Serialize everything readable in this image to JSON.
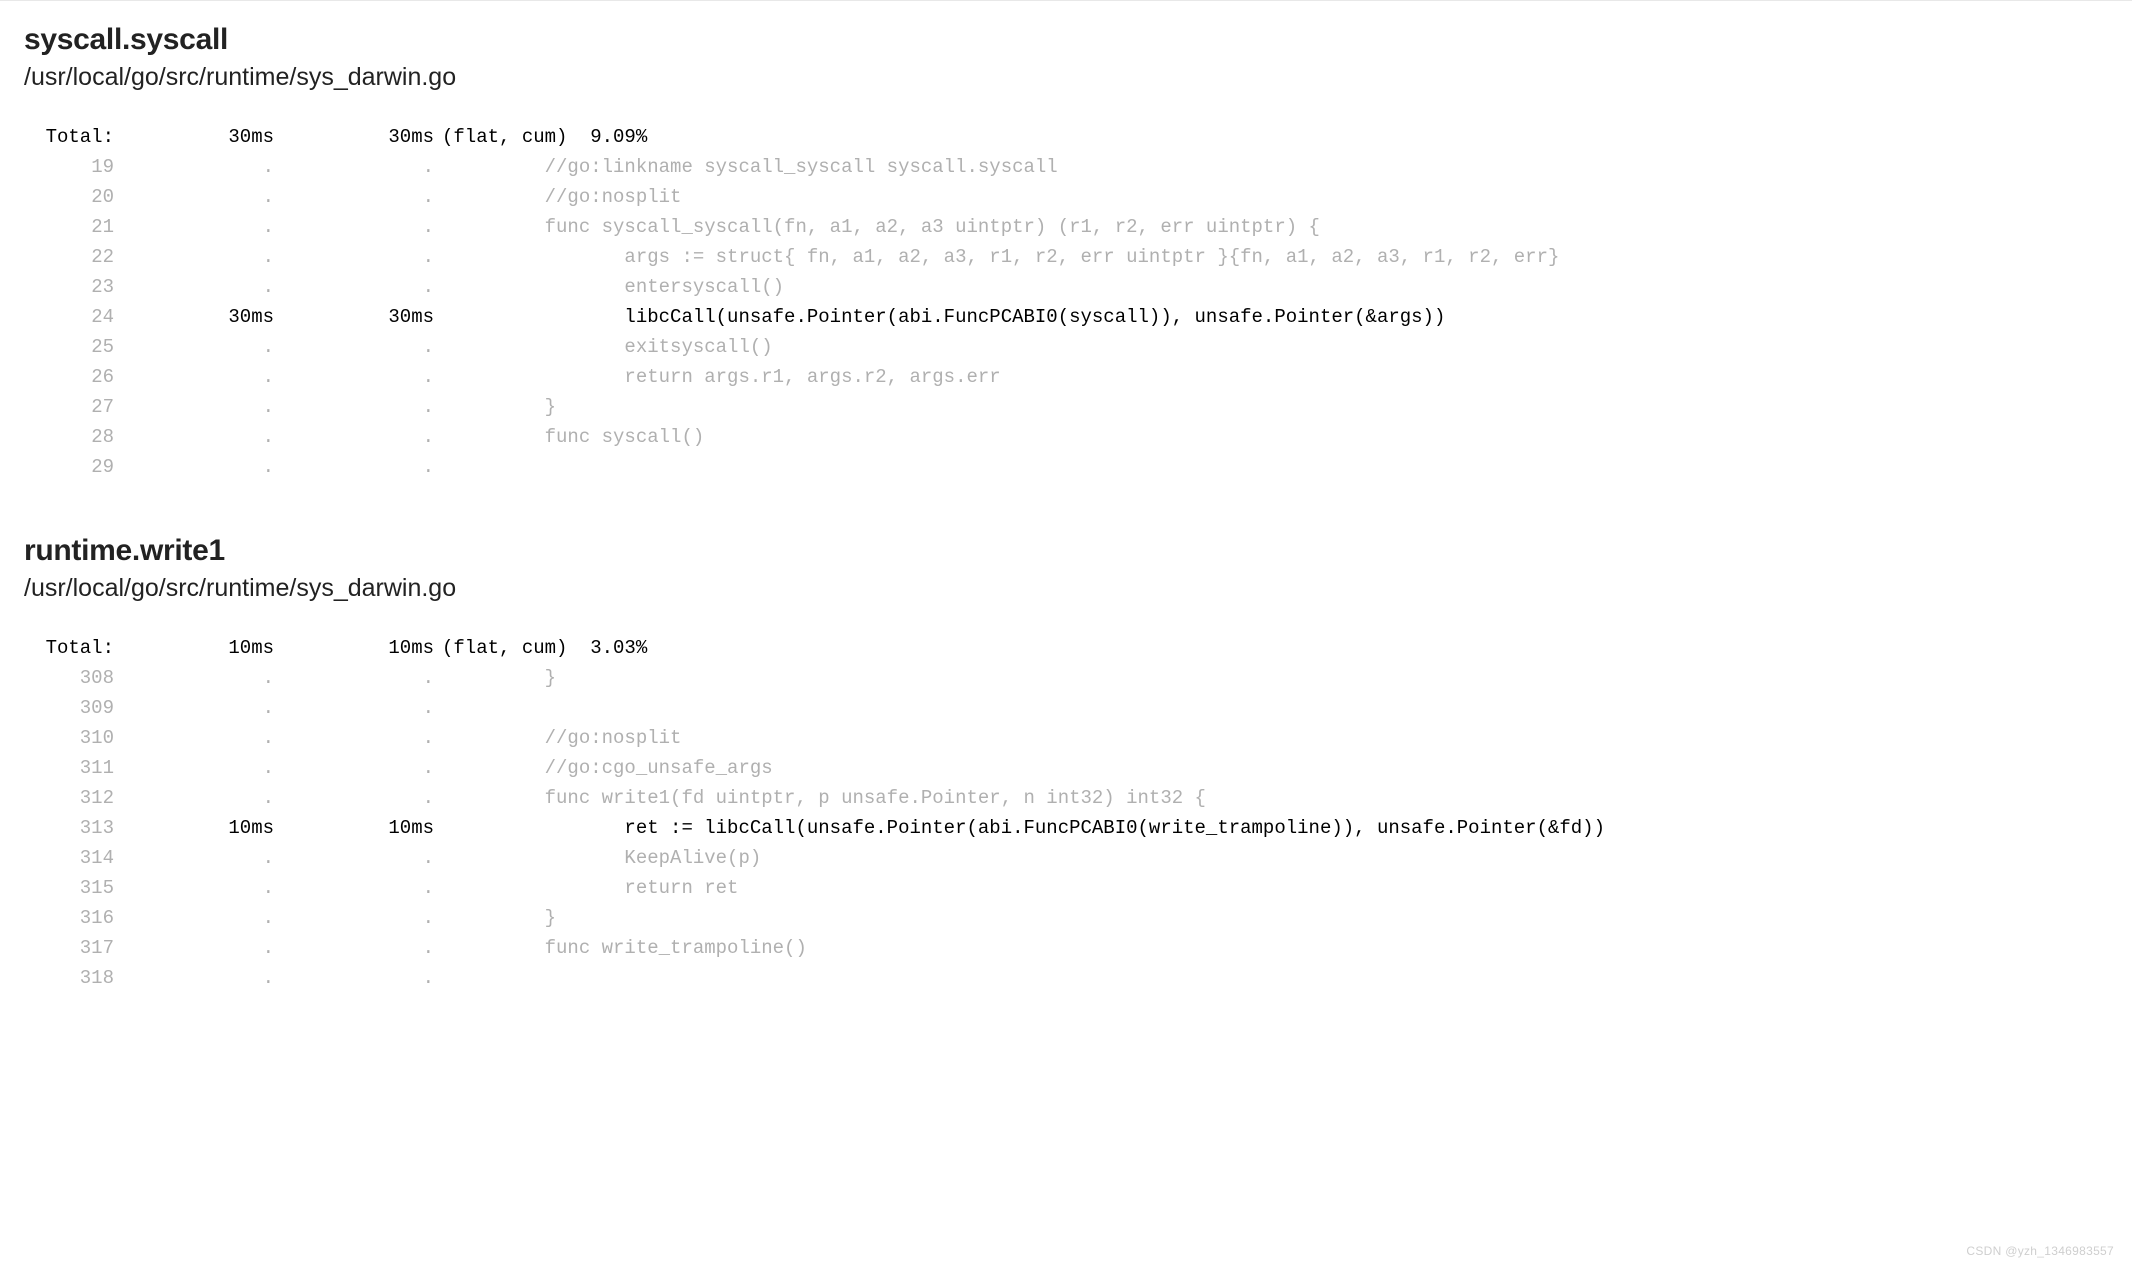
{
  "watermark": "CSDN @yzh_1346983557",
  "sections": [
    {
      "name": "syscall.syscall",
      "path": "/usr/local/go/src/runtime/sys_darwin.go",
      "total": {
        "label": "Total:",
        "flat": "30ms",
        "cum": "30ms",
        "meta": "(flat, cum)  9.09%"
      },
      "lines": [
        {
          "n": "19",
          "flat": ".",
          "cum": ".",
          "src": "         //go:linkname syscall_syscall syscall.syscall",
          "hl": false
        },
        {
          "n": "20",
          "flat": ".",
          "cum": ".",
          "src": "         //go:nosplit",
          "hl": false
        },
        {
          "n": "21",
          "flat": ".",
          "cum": ".",
          "src": "         func syscall_syscall(fn, a1, a2, a3 uintptr) (r1, r2, err uintptr) {",
          "hl": false
        },
        {
          "n": "22",
          "flat": ".",
          "cum": ".",
          "src": "                args := struct{ fn, a1, a2, a3, r1, r2, err uintptr }{fn, a1, a2, a3, r1, r2, err}",
          "hl": false
        },
        {
          "n": "23",
          "flat": ".",
          "cum": ".",
          "src": "                entersyscall()",
          "hl": false
        },
        {
          "n": "24",
          "flat": "30ms",
          "cum": "30ms",
          "src": "                libcCall(unsafe.Pointer(abi.FuncPCABI0(syscall)), unsafe.Pointer(&args))",
          "hl": true
        },
        {
          "n": "25",
          "flat": ".",
          "cum": ".",
          "src": "                exitsyscall()",
          "hl": false
        },
        {
          "n": "26",
          "flat": ".",
          "cum": ".",
          "src": "                return args.r1, args.r2, args.err",
          "hl": false
        },
        {
          "n": "27",
          "flat": ".",
          "cum": ".",
          "src": "         }",
          "hl": false
        },
        {
          "n": "28",
          "flat": ".",
          "cum": ".",
          "src": "         func syscall()",
          "hl": false
        },
        {
          "n": "29",
          "flat": ".",
          "cum": ".",
          "src": "",
          "hl": false
        }
      ]
    },
    {
      "name": "runtime.write1",
      "path": "/usr/local/go/src/runtime/sys_darwin.go",
      "total": {
        "label": "Total:",
        "flat": "10ms",
        "cum": "10ms",
        "meta": "(flat, cum)  3.03%"
      },
      "lines": [
        {
          "n": "308",
          "flat": ".",
          "cum": ".",
          "src": "         }",
          "hl": false
        },
        {
          "n": "309",
          "flat": ".",
          "cum": ".",
          "src": "",
          "hl": false
        },
        {
          "n": "310",
          "flat": ".",
          "cum": ".",
          "src": "         //go:nosplit",
          "hl": false
        },
        {
          "n": "311",
          "flat": ".",
          "cum": ".",
          "src": "         //go:cgo_unsafe_args",
          "hl": false
        },
        {
          "n": "312",
          "flat": ".",
          "cum": ".",
          "src": "         func write1(fd uintptr, p unsafe.Pointer, n int32) int32 {",
          "hl": false
        },
        {
          "n": "313",
          "flat": "10ms",
          "cum": "10ms",
          "src": "                ret := libcCall(unsafe.Pointer(abi.FuncPCABI0(write_trampoline)), unsafe.Pointer(&fd))",
          "hl": true
        },
        {
          "n": "314",
          "flat": ".",
          "cum": ".",
          "src": "                KeepAlive(p)",
          "hl": false
        },
        {
          "n": "315",
          "flat": ".",
          "cum": ".",
          "src": "                return ret",
          "hl": false
        },
        {
          "n": "316",
          "flat": ".",
          "cum": ".",
          "src": "         }",
          "hl": false
        },
        {
          "n": "317",
          "flat": ".",
          "cum": ".",
          "src": "         func write_trampoline()",
          "hl": false
        },
        {
          "n": "318",
          "flat": ".",
          "cum": ".",
          "src": "",
          "hl": false
        }
      ]
    }
  ]
}
